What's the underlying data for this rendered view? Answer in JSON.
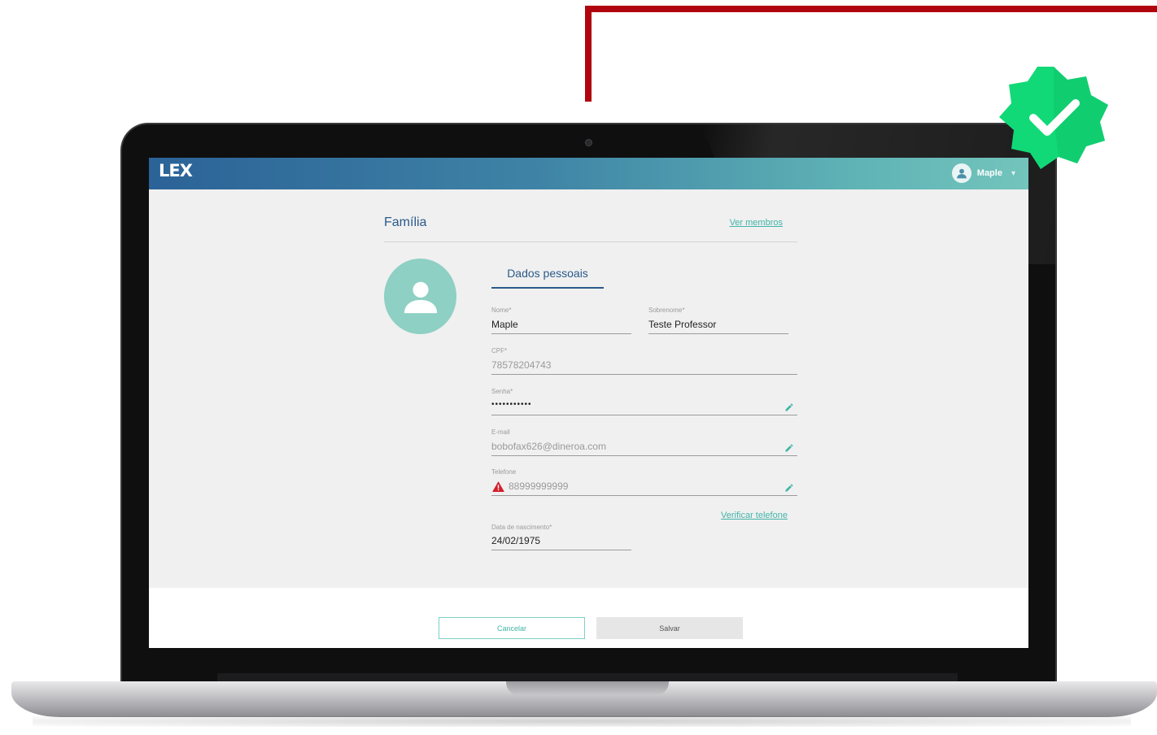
{
  "app": {
    "logo": "LEX",
    "user_name": "Maple"
  },
  "page": {
    "title": "Família",
    "members_link": "Ver membros",
    "tab_personal": "Dados pessoais"
  },
  "form": {
    "nome": {
      "label": "Nome*",
      "value": "Maple"
    },
    "sobrenome": {
      "label": "Sobrenome*",
      "value": "Teste Professor"
    },
    "cpf": {
      "label": "CPF*",
      "value": "78578204743"
    },
    "senha": {
      "label": "Senha*",
      "value": "•••••••••••"
    },
    "email": {
      "label": "E-mail",
      "value": "bobofax626@dineroa.com"
    },
    "telefone": {
      "label": "Telefone",
      "value": "88999999999"
    },
    "verify_link": "Verificar telefone",
    "nascimento": {
      "label": "Data de nascimento*",
      "value": "24/02/1975"
    }
  },
  "actions": {
    "cancel": "Cancelar",
    "save": "Salvar"
  },
  "colors": {
    "accent": "#42b4a8",
    "primary": "#2b5a8a",
    "warning": "#d0202a",
    "badge": "#12d977",
    "connector": "#b0050e"
  },
  "icons": [
    "user-icon",
    "chevron-down-icon",
    "pencil-icon",
    "warning-icon",
    "verified-badge-icon"
  ]
}
